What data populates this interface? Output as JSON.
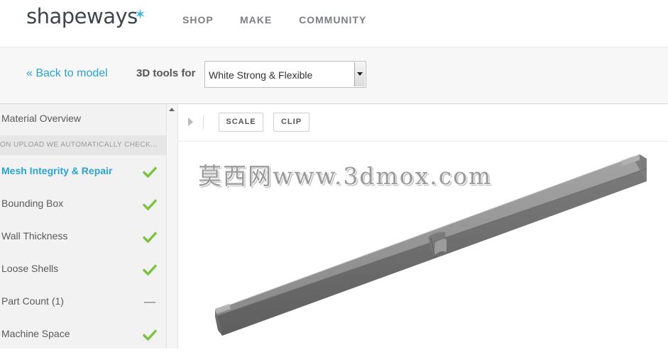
{
  "brand": {
    "name": "shapeways",
    "star": "✶"
  },
  "nav": [
    {
      "label": "SHOP"
    },
    {
      "label": "MAKE"
    },
    {
      "label": "COMMUNITY"
    }
  ],
  "tools": {
    "back_label": "« Back to model",
    "tools_label": "3D tools for",
    "material_selected": "White Strong & Flexible"
  },
  "sidebar": {
    "overview": "Material Overview",
    "note": "ON UPLOAD WE AUTOMATICALLY CHECK...",
    "checks": [
      {
        "label": "Mesh Integrity & Repair",
        "status": "pass",
        "active": true
      },
      {
        "label": "Bounding Box",
        "status": "pass"
      },
      {
        "label": "Wall Thickness",
        "status": "pass"
      },
      {
        "label": "Loose Shells",
        "status": "pass"
      },
      {
        "label": "Part Count (1)",
        "status": "neutral"
      },
      {
        "label": "Machine Space",
        "status": "pass"
      }
    ]
  },
  "viewer": {
    "scale_label": "SCALE",
    "clip_label": "CLIP"
  },
  "watermark": "莫西网www.3dmox.com",
  "colors": {
    "accent": "#2aa3cf",
    "check": "#7dc242",
    "model": "#8e8e8e"
  }
}
